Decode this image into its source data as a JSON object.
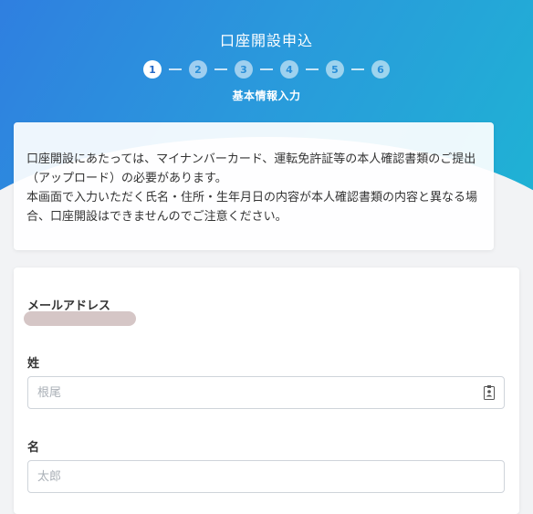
{
  "header": {
    "title": "口座開設申込",
    "steps": [
      "1",
      "2",
      "3",
      "4",
      "5",
      "6"
    ],
    "current_step": 1,
    "step_label": "基本情報入力"
  },
  "notice": {
    "paragraph1": "口座開設にあたっては、マイナンバーカード、運転免許証等の本人確認書類のご提出（アップロード）の必要があります。",
    "paragraph2": "本画面で入力いただく氏名・住所・生年月日の内容が本人確認書類の内容と異なる場合、口座開設はできませんのでご注意ください。"
  },
  "form": {
    "email_label": "メールアドレス",
    "last_name_label": "姓",
    "last_name_placeholder": "根尾",
    "first_name_label": "名",
    "first_name_placeholder": "太郎"
  },
  "colors": {
    "gradient_start": "#2f7fe0",
    "gradient_end": "#1fb3d4",
    "active_step": "#ffffff"
  }
}
